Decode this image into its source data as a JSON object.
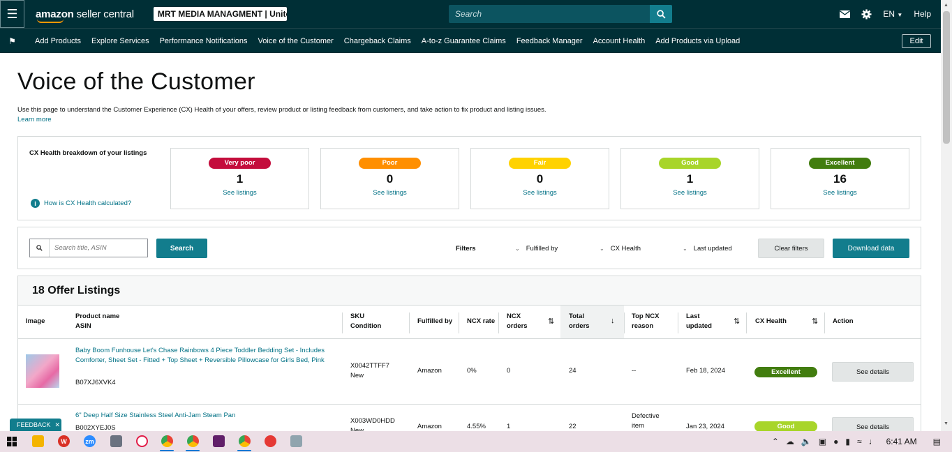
{
  "topbar": {
    "brand_bold": "amazon",
    "brand_rest": "seller central",
    "store_name": "MRT MEDIA MANAGMENT | Unite...",
    "search_placeholder": "Search",
    "language": "EN",
    "help": "Help"
  },
  "nav": {
    "items": [
      "Add Products",
      "Explore Services",
      "Performance Notifications",
      "Voice of the Customer",
      "Chargeback Claims",
      "A-to-z Guarantee Claims",
      "Feedback Manager",
      "Account Health",
      "Add Products via Upload"
    ],
    "edit": "Edit"
  },
  "page": {
    "title": "Voice of the Customer",
    "description": "Use this page to understand the Customer Experience (CX) Health of your offers, review product or listing feedback from customers, and take action to fix product and listing issues.",
    "learn_more": "Learn more"
  },
  "cx_breakdown": {
    "heading": "CX Health breakdown of your listings",
    "help_link": "How is CX Health calculated?",
    "cards": [
      {
        "label": "Very poor",
        "count": "1",
        "link": "See listings",
        "color": "#c40d3c"
      },
      {
        "label": "Poor",
        "count": "0",
        "link": "See listings",
        "color": "#ff8f00"
      },
      {
        "label": "Fair",
        "count": "0",
        "link": "See listings",
        "color": "#ffd200"
      },
      {
        "label": "Good",
        "count": "1",
        "link": "See listings",
        "color": "#a8d52a"
      },
      {
        "label": "Excellent",
        "count": "16",
        "link": "See listings",
        "color": "#427d0f"
      }
    ]
  },
  "filters": {
    "search_placeholder": "Search title, ASIN",
    "search_button": "Search",
    "label": "Filters",
    "fulfilled_by": "Fulfilled by",
    "cx_health": "CX Health",
    "last_updated": "Last updated",
    "clear": "Clear filters",
    "download": "Download data"
  },
  "table": {
    "title": "18 Offer Listings",
    "headers": {
      "image": "Image",
      "product_name": "Product name",
      "asin": "ASIN",
      "sku": "SKU",
      "condition": "Condition",
      "fulfilled_by": "Fulfilled by",
      "ncx_rate": "NCX rate",
      "ncx_orders_1": "NCX",
      "ncx_orders_2": "orders",
      "total_orders_1": "Total",
      "total_orders_2": "orders",
      "top_ncx_1": "Top NCX",
      "top_ncx_2": "reason",
      "last_updated_1": "Last",
      "last_updated_2": "updated",
      "cx_health": "CX Health",
      "action": "Action"
    },
    "rows": [
      {
        "name": "Baby Boom Funhouse Let's Chase Rainbows 4 Piece Toddler Bedding Set - Includes Comforter, Sheet Set - Fitted + Top Sheet + Reversible Pillowcase for Girls Bed, Pink",
        "asin": "B07XJ6XVK4",
        "sku": "X0042TTFF7",
        "condition": "New",
        "fulfilled_by": "Amazon",
        "ncx_rate": "0%",
        "ncx_orders": "0",
        "total_orders": "24",
        "top_ncx": "--",
        "last_updated": "Feb 18, 2024",
        "cx_health": "Excellent",
        "cx_color": "#427d0f",
        "action": "See details"
      },
      {
        "name": "6\" Deep Half Size Stainless Steel Anti-Jam Steam Pan",
        "asin": "B002XYEJ0S",
        "sku": "X003WD0HDD",
        "condition": "New",
        "fulfilled_by": "Amazon",
        "ncx_rate": "4.55%",
        "ncx_orders": "1",
        "total_orders": "22",
        "top_ncx_1": "Defective",
        "top_ncx_2": "item",
        "last_updated": "Jan 23, 2024",
        "cx_health": "Good",
        "cx_color": "#a8d52a",
        "action": "See details"
      }
    ]
  },
  "feedback_tab": "FEEDBACK",
  "taskbar": {
    "time": "6:41 AM"
  }
}
